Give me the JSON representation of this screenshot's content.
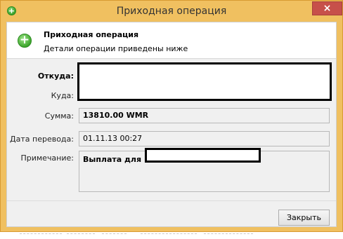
{
  "window": {
    "title": "Приходная операция",
    "close_label": "×",
    "colors": {
      "frame": "#f0c060",
      "close": "#c7504a",
      "accent": "#3ba42b"
    }
  },
  "header": {
    "title": "Приходная операция",
    "subtitle": "Детали операции приведены ниже",
    "icon": "add-circle-icon"
  },
  "form": {
    "from_label": "Откуда:",
    "to_label": "Куда:",
    "amount_label": "Сумма:",
    "amount_value": "13810.00 WMR",
    "date_label": "Дата перевода:",
    "date_value": "01.11.13 00:27",
    "note_label": "Примечание:",
    "note_value": "Выплата для"
  },
  "footer": {
    "close_button": "Закрыть"
  }
}
